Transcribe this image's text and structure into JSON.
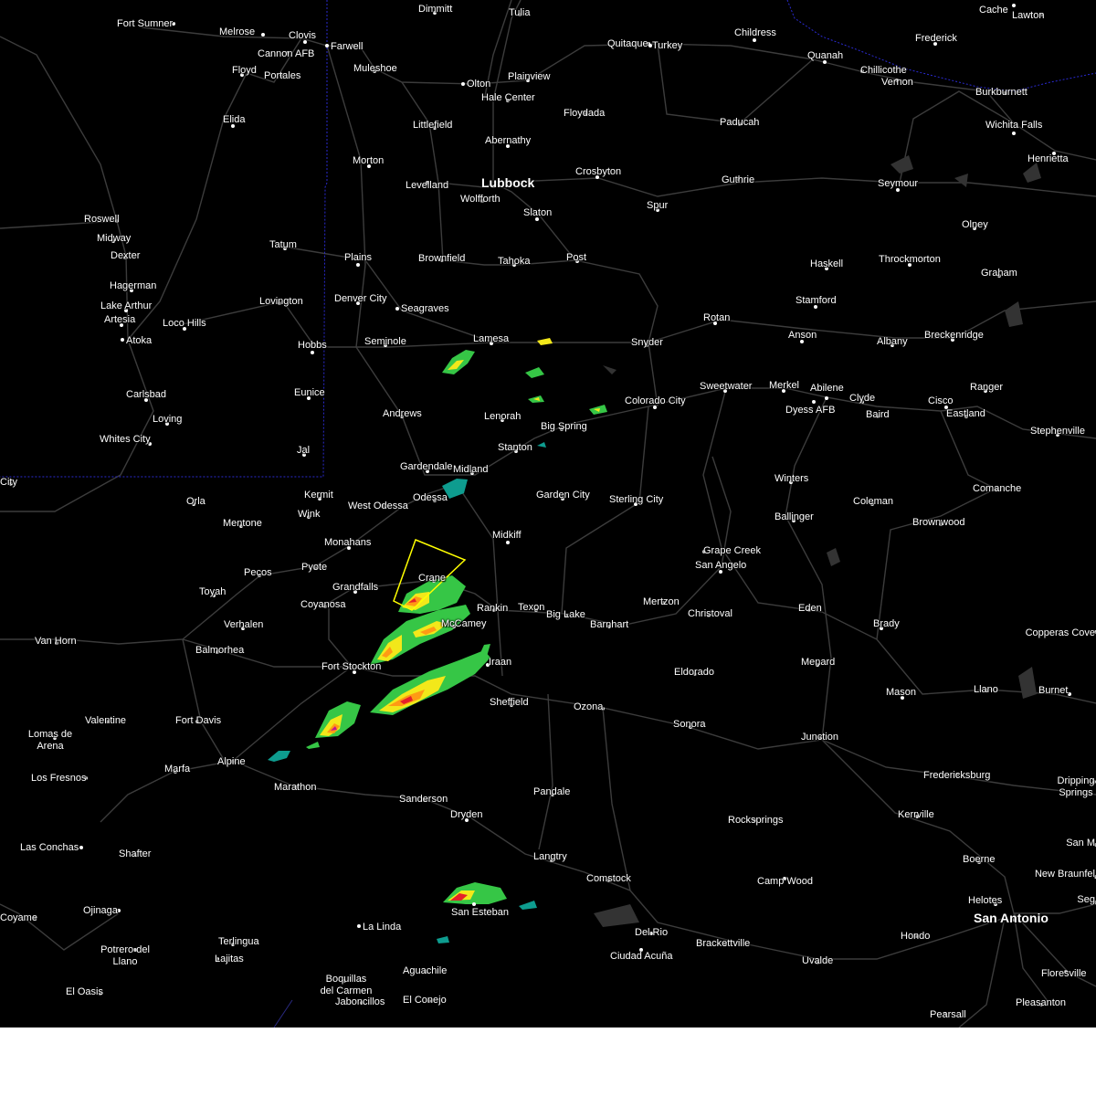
{
  "map": {
    "colors": {
      "background": "#000000",
      "roads": "#4a4a4a",
      "state_border": "#2a2ad0",
      "warning_polygon": "#ffff00",
      "label": "#ffffff",
      "radar_light": "#0e9c8f",
      "radar_green": "#36c646",
      "radar_yellow": "#f2e81a",
      "radar_orange": "#ff9a14",
      "radar_red": "#e5202a",
      "radar_magenta": "#c01890"
    },
    "cities": [
      {
        "name": "Dimmitt"
      },
      {
        "name": "Tulia"
      },
      {
        "name": "Cache"
      },
      {
        "name": "Lawton"
      },
      {
        "name": "Fort Sumner"
      },
      {
        "name": "Melrose"
      },
      {
        "name": "Clovis"
      },
      {
        "name": "Farwell"
      },
      {
        "name": "Cannon AFB"
      },
      {
        "name": "Floyd"
      },
      {
        "name": "Portales"
      },
      {
        "name": "Muleshoe"
      },
      {
        "name": "Quitaque"
      },
      {
        "name": "Turkey"
      },
      {
        "name": "Childress"
      },
      {
        "name": "Frederick"
      },
      {
        "name": "Quanah"
      },
      {
        "name": "Chillicothe"
      },
      {
        "name": "Vernon"
      },
      {
        "name": "Olton"
      },
      {
        "name": "Plainview"
      },
      {
        "name": "Hale Center"
      },
      {
        "name": "Burkburnett"
      },
      {
        "name": "Wichita Falls"
      },
      {
        "name": "Elida"
      },
      {
        "name": "Littlefield"
      },
      {
        "name": "Floydada"
      },
      {
        "name": "Paducah"
      },
      {
        "name": "Abernathy"
      },
      {
        "name": "Henrietta"
      },
      {
        "name": "Morton"
      },
      {
        "name": "Levelland"
      },
      {
        "name": "Lubbock"
      },
      {
        "name": "Wolfforth"
      },
      {
        "name": "Crosbyton"
      },
      {
        "name": "Guthrie"
      },
      {
        "name": "Seymour"
      },
      {
        "name": "Slaton"
      },
      {
        "name": "Spur"
      },
      {
        "name": "Roswell"
      },
      {
        "name": "Olney"
      },
      {
        "name": "Midway"
      },
      {
        "name": "Tatum"
      },
      {
        "name": "Dexter"
      },
      {
        "name": "Plains"
      },
      {
        "name": "Brownfield"
      },
      {
        "name": "Tahoka"
      },
      {
        "name": "Post"
      },
      {
        "name": "Haskell"
      },
      {
        "name": "Throckmorton"
      },
      {
        "name": "Graham"
      },
      {
        "name": "Hagerman"
      },
      {
        "name": "Lovington"
      },
      {
        "name": "Denver City"
      },
      {
        "name": "Lake Arthur"
      },
      {
        "name": "Seagraves"
      },
      {
        "name": "Stamford"
      },
      {
        "name": "Artesia"
      },
      {
        "name": "Loco Hills"
      },
      {
        "name": "Rotan"
      },
      {
        "name": "Anson"
      },
      {
        "name": "Breckenridge"
      },
      {
        "name": "Atoka"
      },
      {
        "name": "Seminole"
      },
      {
        "name": "Hobbs"
      },
      {
        "name": "Lamesa"
      },
      {
        "name": "Snyder"
      },
      {
        "name": "Albany"
      },
      {
        "name": "Sweetwater"
      },
      {
        "name": "Merkel"
      },
      {
        "name": "Abilene"
      },
      {
        "name": "Ranger"
      },
      {
        "name": "Carlsbad"
      },
      {
        "name": "Eunice"
      },
      {
        "name": "Colorado City"
      },
      {
        "name": "Clyde"
      },
      {
        "name": "Cisco"
      },
      {
        "name": "Dyess AFB"
      },
      {
        "name": "Eastland"
      },
      {
        "name": "Andrews"
      },
      {
        "name": "Lenorah"
      },
      {
        "name": "Baird"
      },
      {
        "name": "Loving"
      },
      {
        "name": "Big Spring"
      },
      {
        "name": "Stephenville"
      },
      {
        "name": "Whites City"
      },
      {
        "name": "Stanton"
      },
      {
        "name": "Jal"
      },
      {
        "name": "Gardendale"
      },
      {
        "name": "Midland"
      },
      {
        "name": "Winters"
      },
      {
        "name": "City"
      },
      {
        "name": "Comanche"
      },
      {
        "name": "Kermit"
      },
      {
        "name": "Odessa"
      },
      {
        "name": "Garden City"
      },
      {
        "name": "Orla"
      },
      {
        "name": "West Odessa"
      },
      {
        "name": "Sterling City"
      },
      {
        "name": "Coleman"
      },
      {
        "name": "Wink"
      },
      {
        "name": "Ballinger"
      },
      {
        "name": "Mentone"
      },
      {
        "name": "Brownwood"
      },
      {
        "name": "Midkiff"
      },
      {
        "name": "Monahans"
      },
      {
        "name": "Grape Creek"
      },
      {
        "name": "Pyote"
      },
      {
        "name": "San Angelo"
      },
      {
        "name": "Pecos"
      },
      {
        "name": "Crane"
      },
      {
        "name": "Grandfalls"
      },
      {
        "name": "Toyah"
      },
      {
        "name": "Coyanosa"
      },
      {
        "name": "Rankin"
      },
      {
        "name": "Texon"
      },
      {
        "name": "Mertzon"
      },
      {
        "name": "Big Lake"
      },
      {
        "name": "Eden"
      },
      {
        "name": "Christoval"
      },
      {
        "name": "Verhalen"
      },
      {
        "name": "McCamey"
      },
      {
        "name": "Barnhart"
      },
      {
        "name": "Brady"
      },
      {
        "name": "Van Horn"
      },
      {
        "name": "Copperas Cove"
      },
      {
        "name": "Balmorhea"
      },
      {
        "name": "Menard"
      },
      {
        "name": "Fort Stockton"
      },
      {
        "name": "Iraan"
      },
      {
        "name": "Eldorado"
      },
      {
        "name": "Llano"
      },
      {
        "name": "Burnet"
      },
      {
        "name": "Mason"
      },
      {
        "name": "Sheffield"
      },
      {
        "name": "Ozona"
      },
      {
        "name": "Valentine"
      },
      {
        "name": "Fort Davis"
      },
      {
        "name": "Sonora"
      },
      {
        "name": "Lomas de Arena"
      },
      {
        "name": "Junction"
      },
      {
        "name": "Alpine"
      },
      {
        "name": "Marfa"
      },
      {
        "name": "Fredericksburg"
      },
      {
        "name": "Los Fresnos"
      },
      {
        "name": "Dripping Springs"
      },
      {
        "name": "Marathon"
      },
      {
        "name": "Pandale"
      },
      {
        "name": "Sanderson"
      },
      {
        "name": "Kerrville"
      },
      {
        "name": "Dryden"
      },
      {
        "name": "Rocksprings"
      },
      {
        "name": "Las Conchas"
      },
      {
        "name": "Shafter"
      },
      {
        "name": "San M"
      },
      {
        "name": "Langtry"
      },
      {
        "name": "Boerne"
      },
      {
        "name": "New Braunfel"
      },
      {
        "name": "Comstock"
      },
      {
        "name": "Camp Wood"
      },
      {
        "name": "Helotes"
      },
      {
        "name": "San Esteban"
      },
      {
        "name": "Coyame"
      },
      {
        "name": "Ojinaga"
      },
      {
        "name": "San Antonio"
      },
      {
        "name": "Seg"
      },
      {
        "name": "Del Rio"
      },
      {
        "name": "Hondo"
      },
      {
        "name": "La Linda"
      },
      {
        "name": "Brackettville"
      },
      {
        "name": "Terlingua"
      },
      {
        "name": "Potrero del Llano"
      },
      {
        "name": "Ciudad Acuña"
      },
      {
        "name": "Uvalde"
      },
      {
        "name": "Lajitas"
      },
      {
        "name": "Aguachile"
      },
      {
        "name": "Floresville"
      },
      {
        "name": "Boquillas del Carmen"
      },
      {
        "name": "El Oasis"
      },
      {
        "name": "Jaboncillos"
      },
      {
        "name": "El Conejo"
      },
      {
        "name": "Pleasanton"
      },
      {
        "name": "Pearsall"
      }
    ]
  }
}
